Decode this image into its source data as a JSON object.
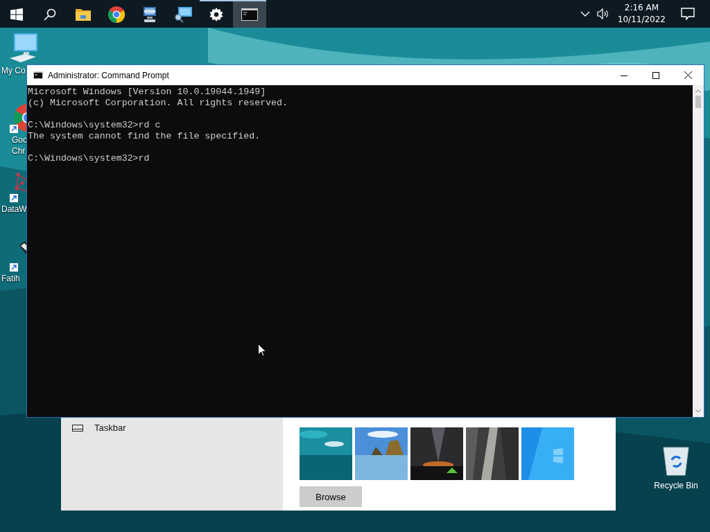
{
  "taskbar": {
    "items": [
      {
        "kind": "start",
        "running": false,
        "selected": false
      },
      {
        "kind": "search",
        "running": false,
        "selected": false
      },
      {
        "kind": "folder",
        "running": false,
        "selected": false
      },
      {
        "kind": "chrome",
        "running": false,
        "selected": false
      },
      {
        "kind": "network",
        "running": false,
        "selected": false
      },
      {
        "kind": "remote",
        "running": false,
        "selected": false
      },
      {
        "kind": "settings",
        "running": true,
        "selected": false
      },
      {
        "kind": "console",
        "running": true,
        "selected": true
      }
    ],
    "tray": {
      "time": "2:16 AM",
      "date": "10/11/2022"
    }
  },
  "desktop_icons": [
    {
      "kind": "computer",
      "shortcut": false,
      "lines": [
        "My Co"
      ]
    },
    {
      "kind": "chrome",
      "shortcut": true,
      "lines": [
        "Goo",
        "Chr"
      ]
    },
    {
      "kind": "molecule",
      "shortcut": true,
      "lines": [
        "DataW"
      ]
    },
    {
      "kind": "usb",
      "shortcut": true,
      "lines": [
        "Fatih"
      ]
    }
  ],
  "recycle_bin": {
    "label": "Recycle Bin"
  },
  "settings_window": {
    "nav_items": [
      {
        "label": "Taskbar"
      }
    ],
    "browse_button": "Browse"
  },
  "console_window": {
    "title": "Administrator: Command Prompt",
    "paragraphs": [
      [
        "Microsoft Windows [Version 10.0.19044.1949]",
        "(c) Microsoft Corporation. All rights reserved."
      ],
      [
        "C:\\Windows\\system32>rd c",
        "The system cannot find the file specified."
      ],
      [
        "C:\\Windows\\system32>rd"
      ]
    ]
  }
}
